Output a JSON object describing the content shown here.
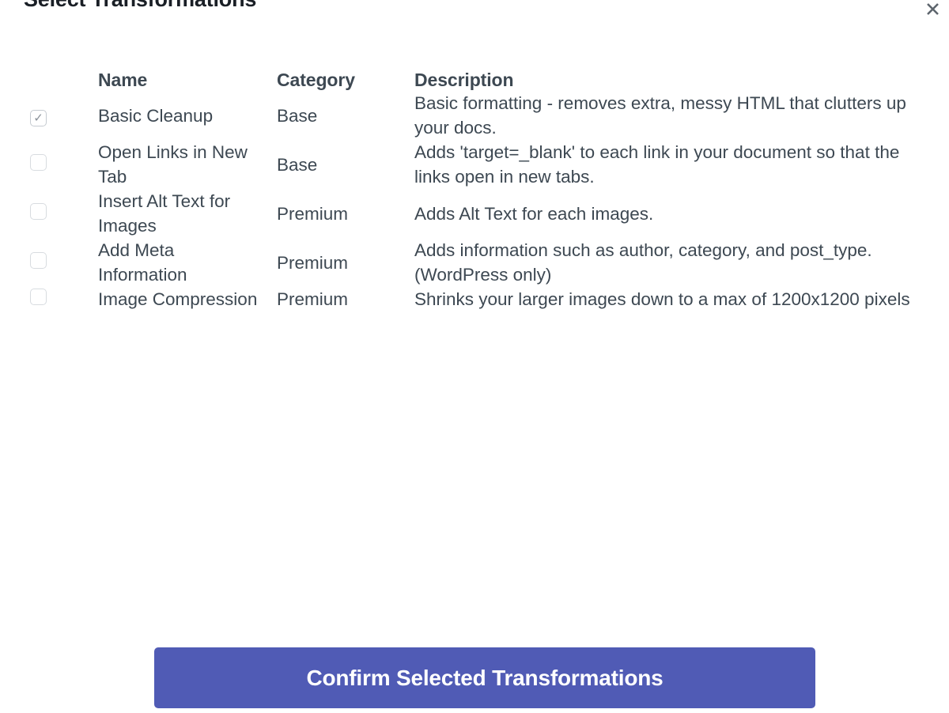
{
  "modal": {
    "title": "Select Transformations",
    "close_label": "✕",
    "close_icon": "close-icon"
  },
  "table": {
    "columns": [
      "",
      "Name",
      "Category",
      "Description"
    ],
    "headers": {
      "name": "Name",
      "category": "Category",
      "description": "Description"
    },
    "rows": [
      {
        "checked": true,
        "name": "Basic Cleanup",
        "category": "Base",
        "description": "Basic formatting - removes extra, messy HTML that clutters up your docs."
      },
      {
        "checked": false,
        "name": "Open Links in New Tab",
        "category": "Base",
        "description": "Adds 'target=_blank' to each link in your document so that the links open in new tabs."
      },
      {
        "checked": false,
        "name": "Insert Alt Text for Images",
        "category": "Premium",
        "description": "Adds Alt Text for each images."
      },
      {
        "checked": false,
        "name": "Add Meta Information",
        "category": "Premium",
        "description": "Adds information such as author, category, and post_type. (WordPress only)"
      },
      {
        "checked": false,
        "name": "Image Compression",
        "category": "Premium",
        "description": "Shrinks your larger images down to a max of 1200x1200 pixels"
      }
    ]
  },
  "footer": {
    "confirm_label": "Confirm Selected Transformations"
  },
  "colors": {
    "accent": "#505bb5",
    "text": "#3d4852",
    "title": "#1a1f26",
    "checkbox_border": "#d8dce0",
    "check_tick": "#8a9199",
    "background": "#ffffff"
  }
}
